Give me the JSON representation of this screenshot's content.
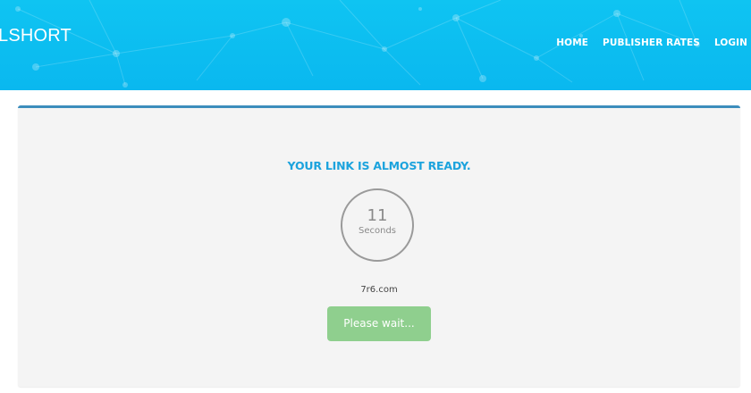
{
  "header": {
    "brand": "LSHORT",
    "nav": [
      {
        "label": "HOME"
      },
      {
        "label": "PUBLISHER RATES"
      },
      {
        "label": "LOGIN"
      }
    ],
    "bg_color": "#0ab8ef"
  },
  "card": {
    "title": "YOUR LINK IS ALMOST READY.",
    "countdown": {
      "value": "11",
      "unit": "Seconds"
    },
    "domain": "7r6.com",
    "button_label": "Please wait...",
    "accent_color": "#3c8dbc",
    "title_color": "#1ca3dd",
    "button_color": "#8fcf8e"
  }
}
